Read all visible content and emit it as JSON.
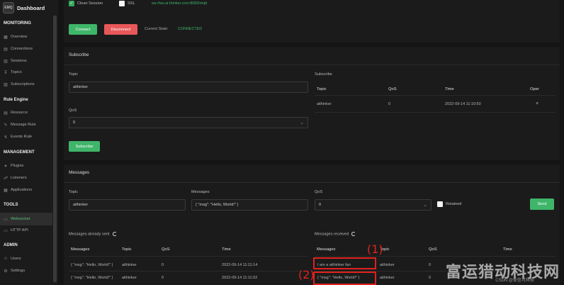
{
  "app": {
    "logo_text": "EMQ",
    "title": "Dashboard"
  },
  "sidebar": {
    "sections": [
      {
        "title": "MONITORING"
      },
      {
        "title": "Rule Engine"
      },
      {
        "title": "MANAGEMENT"
      },
      {
        "title": "TOOLS"
      },
      {
        "title": "ADMIN"
      }
    ],
    "items": [
      {
        "label": "Overview",
        "icon": "grid-icon"
      },
      {
        "label": "Connections",
        "icon": "link-icon"
      },
      {
        "label": "Sessions",
        "icon": "sessions-icon"
      },
      {
        "label": "Topics",
        "icon": "topic-icon"
      },
      {
        "label": "Subscriptions",
        "icon": "subscription-icon"
      },
      {
        "label": "Resource",
        "icon": "resource-icon"
      },
      {
        "label": "Message Rule",
        "icon": "rule-icon"
      },
      {
        "label": "Events Rule",
        "icon": "events-icon"
      },
      {
        "label": "Plugins",
        "icon": "plugin-icon"
      },
      {
        "label": "Listeners",
        "icon": "listener-icon"
      },
      {
        "label": "Applications",
        "icon": "apps-icon"
      },
      {
        "label": "Websocket",
        "icon": "websocket-icon"
      },
      {
        "label": "HTTP API",
        "icon": "api-icon"
      },
      {
        "label": "Users",
        "icon": "user-icon"
      },
      {
        "label": "Settings",
        "icon": "gear-icon"
      }
    ]
  },
  "connection": {
    "clean_session_label": "Clean Session",
    "ssl_label": "SSL",
    "url": "ws://ws.ai-thinker.com:8083/mqtt",
    "connect_label": "Connect",
    "disconnect_label": "Disconnect",
    "state_label": "Current State:",
    "state_value": "CONNECTED"
  },
  "subscribe": {
    "title": "Subscribe",
    "topic_label": "Topic",
    "topic_value": "aithinker",
    "qos_label": "QoS",
    "qos_value": "0",
    "button_label": "Subscribe",
    "list_title": "Subscribe",
    "columns": [
      "Topic",
      "QoS",
      "Time",
      "Oper"
    ],
    "rows": [
      {
        "topic": "aithinker",
        "qos": "0",
        "time": "2022-09-14 11:10:50",
        "oper": "×"
      }
    ]
  },
  "messages": {
    "title": "Messages",
    "topic_label": "Topic",
    "topic_value": "aithinker",
    "message_label": "Messages",
    "message_value": "{ \"msg\": \"Hello, World!\" }",
    "qos_label": "QoS",
    "qos_value": "0",
    "retained_label": "Retained",
    "send_label": "Send",
    "sent_title": "Messages already sent",
    "received_title": "Messages received",
    "sent_columns": [
      "Messages",
      "Topic",
      "QoS",
      "Time"
    ],
    "received_columns": [
      "Messages",
      "Topic",
      "QoS",
      "Time"
    ],
    "sent_rows": [
      {
        "message": "{ \"msg\": \"Hello, World!\" }",
        "topic": "aithinker",
        "qos": "0",
        "time": "2022-09-14 11:11:14"
      },
      {
        "message": "{ \"msg\": \"Hello, World!\" }",
        "topic": "aithinker",
        "qos": "0",
        "time": "2022-09-14 11:11:02"
      }
    ],
    "received_rows": [
      {
        "message": "I am a aithinker fan",
        "topic": "aithinker",
        "qos": "0"
      },
      {
        "message": "{ \"msg\": \"Hello, World!\" }",
        "topic": "aithinker",
        "qos": "0"
      }
    ]
  },
  "annotations": [
    "(1)",
    "(2)"
  ],
  "watermark": {
    "large": "富运猎动科技网",
    "small": "CSDN @安信可科技"
  },
  "colors": {
    "accent": "#3fb56a",
    "danger": "#e8585a",
    "annotation": "#e0211e"
  }
}
